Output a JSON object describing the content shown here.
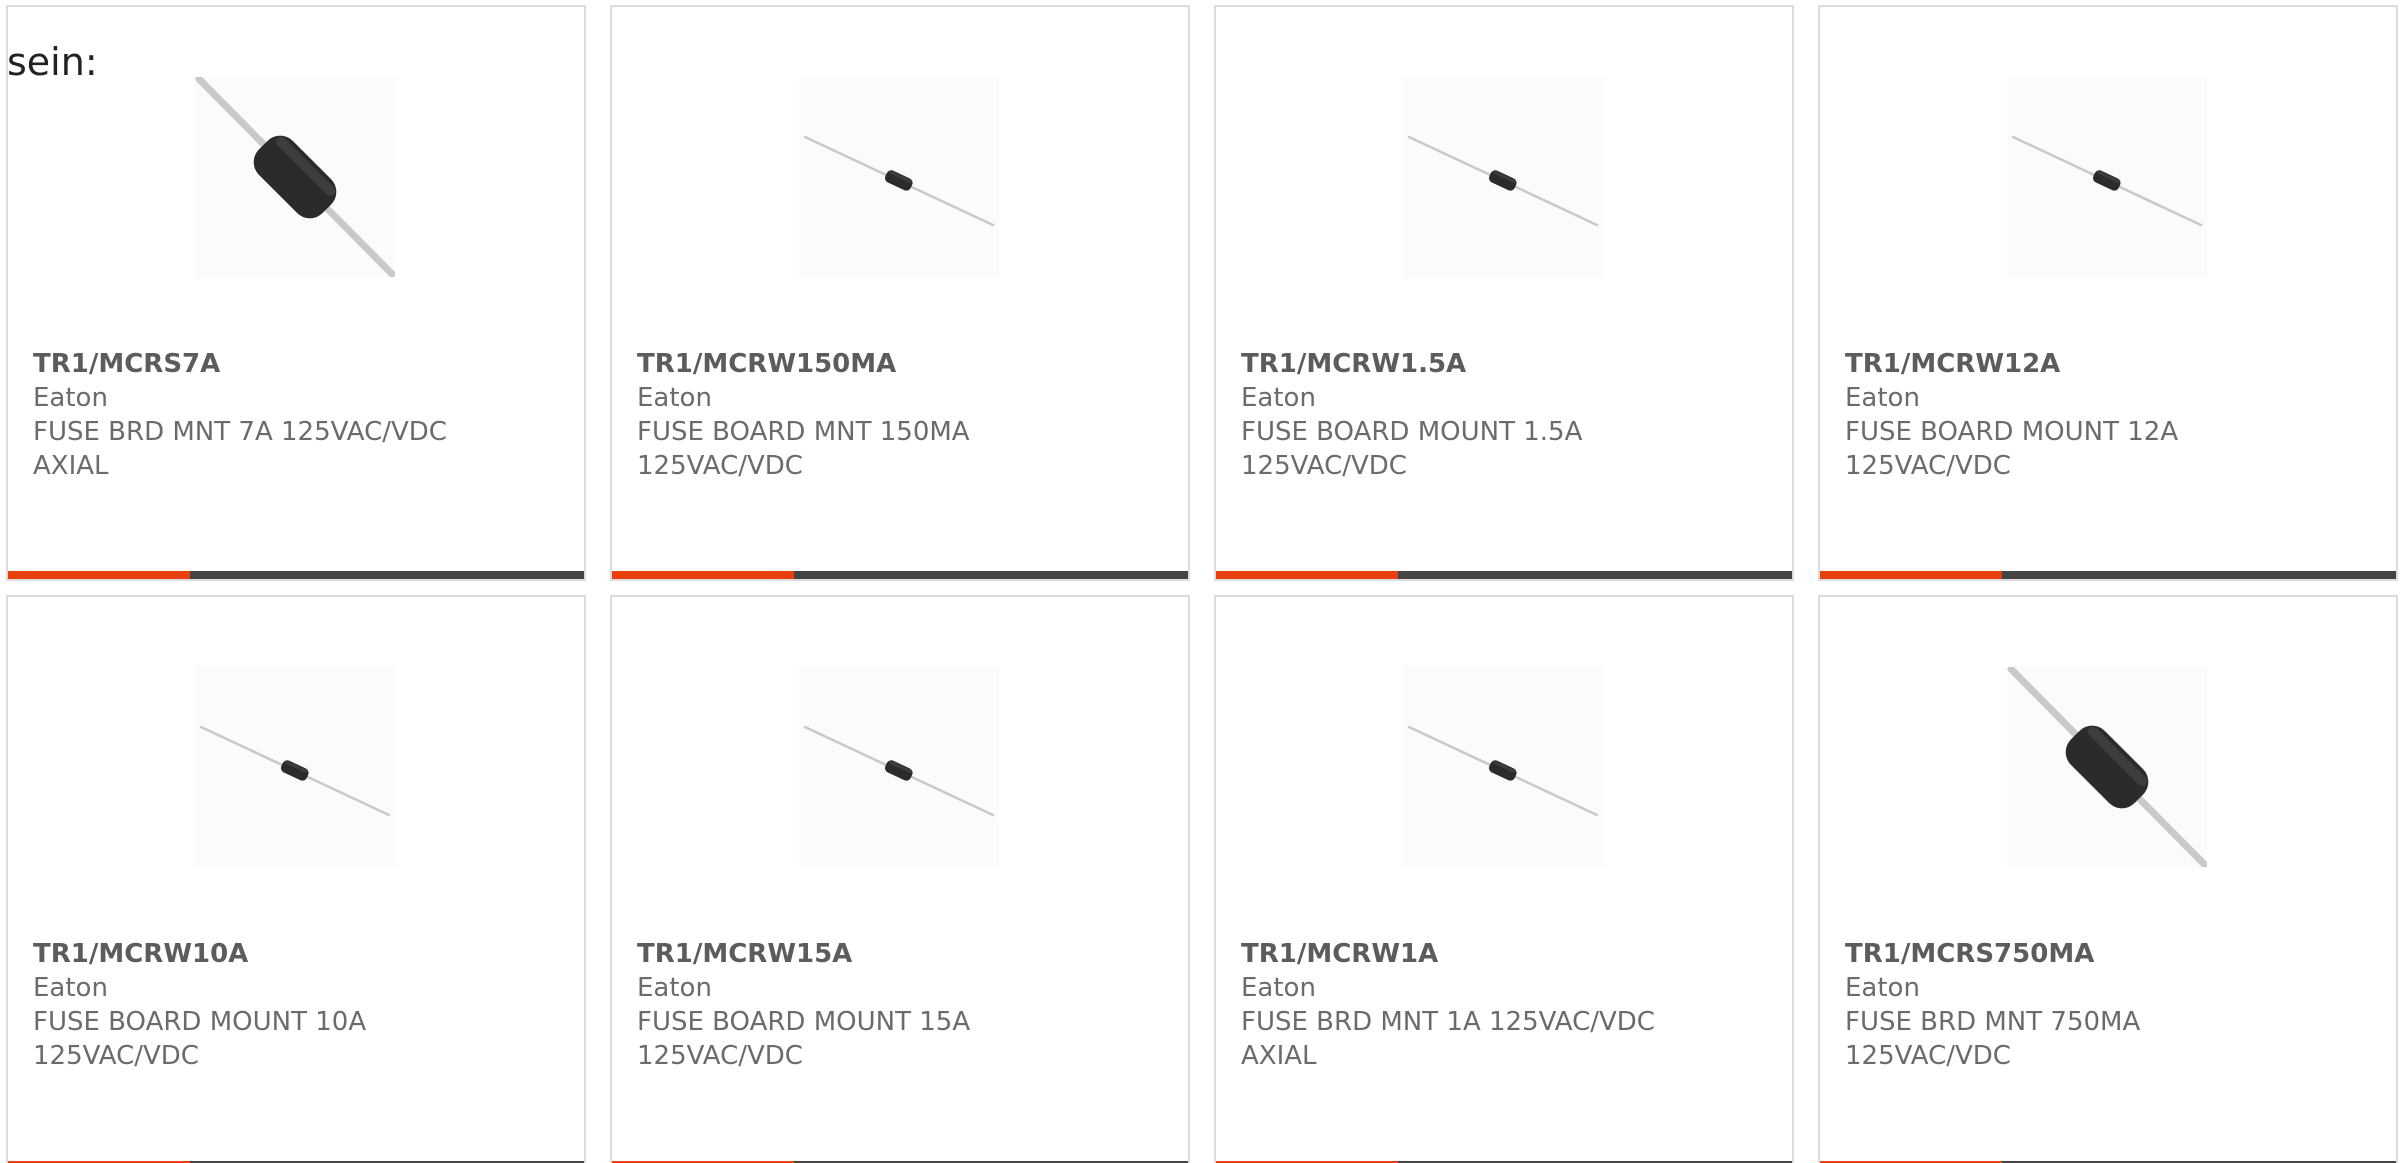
{
  "intro": {
    "text": "sein:"
  },
  "colors": {
    "accent": "#e8400f",
    "footer_bar": "#444444",
    "fuse_body": "#2b2b2b",
    "lead_wire": "#c9c9c9"
  },
  "products": [
    {
      "part_number": "TR1/MCRS7A",
      "manufacturer": "Eaton",
      "description": "FUSE BRD MNT 7A 125VAC/VDC AXIAL",
      "image_icon": "fuse-large-icon"
    },
    {
      "part_number": "TR1/MCRW150MA",
      "manufacturer": "Eaton",
      "description": "FUSE BOARD MNT 150MA 125VAC/VDC",
      "image_icon": "fuse-small-icon"
    },
    {
      "part_number": "TR1/MCRW1.5A",
      "manufacturer": "Eaton",
      "description": "FUSE BOARD MOUNT 1.5A 125VAC/VDC",
      "image_icon": "fuse-small-icon"
    },
    {
      "part_number": "TR1/MCRW12A",
      "manufacturer": "Eaton",
      "description": "FUSE BOARD MOUNT 12A 125VAC/VDC",
      "image_icon": "fuse-small-icon"
    },
    {
      "part_number": "TR1/MCRW10A",
      "manufacturer": "Eaton",
      "description": "FUSE BOARD MOUNT 10A 125VAC/VDC",
      "image_icon": "fuse-small-icon"
    },
    {
      "part_number": "TR1/MCRW15A",
      "manufacturer": "Eaton",
      "description": "FUSE BOARD MOUNT 15A 125VAC/VDC",
      "image_icon": "fuse-small-icon"
    },
    {
      "part_number": "TR1/MCRW1A",
      "manufacturer": "Eaton",
      "description": "FUSE BRD MNT 1A 125VAC/VDC AXIAL",
      "image_icon": "fuse-small-icon"
    },
    {
      "part_number": "TR1/MCRS750MA",
      "manufacturer": "Eaton",
      "description": "FUSE BRD MNT 750MA 125VAC/VDC",
      "image_icon": "fuse-large-icon"
    }
  ]
}
